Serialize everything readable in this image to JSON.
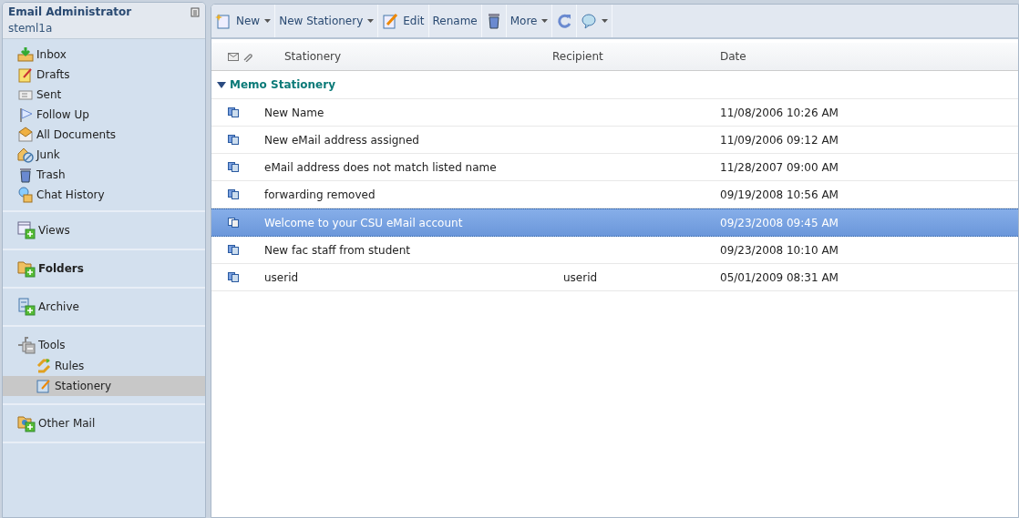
{
  "account": {
    "title": "Email Administrator",
    "user": "steml1a"
  },
  "mail_folders": [
    {
      "label": "Inbox",
      "selected": false
    },
    {
      "label": "Drafts",
      "selected": false
    },
    {
      "label": "Sent",
      "selected": false
    },
    {
      "label": "Follow Up",
      "selected": false
    },
    {
      "label": "All Documents",
      "selected": false
    },
    {
      "label": "Junk",
      "selected": false
    },
    {
      "label": "Trash",
      "selected": false
    },
    {
      "label": "Chat History",
      "selected": false
    }
  ],
  "sections": [
    {
      "label": "Views",
      "expanded": false,
      "bold": false
    },
    {
      "label": "Folders",
      "expanded": false,
      "bold": true
    },
    {
      "label": "Archive",
      "expanded": false,
      "bold": false
    },
    {
      "label": "Tools",
      "expanded": true,
      "bold": false,
      "children": [
        {
          "label": "Rules",
          "selected": false
        },
        {
          "label": "Stationery",
          "selected": true
        }
      ]
    },
    {
      "label": "Other Mail",
      "expanded": false,
      "bold": false
    }
  ],
  "toolbar": [
    {
      "label": "New",
      "dropdown": true
    },
    {
      "label": "New Stationery",
      "dropdown": true
    },
    {
      "label": "Edit",
      "dropdown": false
    },
    {
      "label": "Rename",
      "dropdown": false
    },
    {
      "dropdown": false
    },
    {
      "label": "More",
      "dropdown": true
    },
    {
      "dropdown": false
    },
    {
      "dropdown": true
    }
  ],
  "table": {
    "columns": [
      "Stationery",
      "Recipient",
      "Date"
    ],
    "group": {
      "label": "Memo Stationery",
      "expanded": true
    },
    "rows": [
      {
        "name": "New Name",
        "date": "11/08/2006 10:26 AM",
        "selected": false
      },
      {
        "name": "New eMail address assigned",
        "date": "11/09/2006 09:12 AM",
        "selected": false
      },
      {
        "name": "eMail address does not match listed name",
        "date": "11/28/2007 09:00 AM",
        "selected": false
      },
      {
        "name": "forwarding removed",
        "date": "09/19/2008 10:56 AM",
        "selected": false
      },
      {
        "name": "Welcome to your CSU eMail account",
        "date": "09/23/2008 09:45 AM",
        "selected": true
      },
      {
        "name": "New fac staff from student",
        "date": "09/23/2008 10:10 AM",
        "selected": false
      },
      {
        "name": "userid",
        "recipient": "userid",
        "date": "05/01/2009 08:31 AM",
        "selected": false
      }
    ]
  }
}
